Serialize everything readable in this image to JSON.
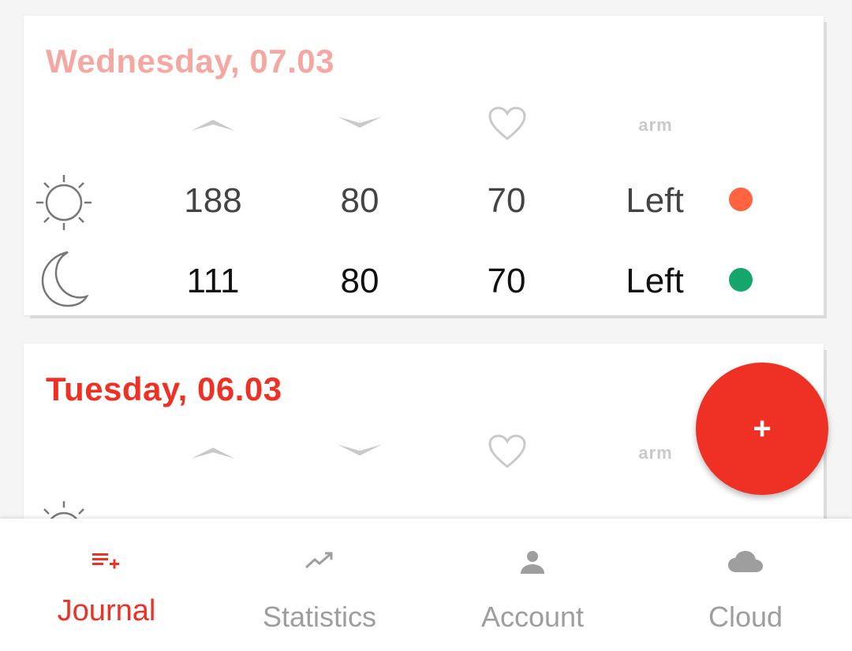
{
  "colors": {
    "accent": "#ee3124",
    "faded_accent": "#f5a8a2",
    "header_icon": "#c9c9c9",
    "inactive_nav": "#9e9e9e",
    "dot_red": "#ff6340",
    "dot_green": "#14a66b"
  },
  "journal": [
    {
      "date": "Wednesday, 07.03",
      "headers": {
        "systolic_icon": "chevron-up-icon",
        "diastolic_icon": "chevron-down-icon",
        "pulse_icon": "heart-icon",
        "arm_label": "arm"
      },
      "rows": [
        {
          "time_icon": "sun-icon",
          "systolic": "188",
          "diastolic": "80",
          "pulse": "70",
          "arm": "Left",
          "status_color": "#ff6340"
        },
        {
          "time_icon": "moon-icon",
          "systolic": "111",
          "diastolic": "80",
          "pulse": "70",
          "arm": "Left",
          "status_color": "#14a66b"
        }
      ]
    },
    {
      "date": "Tuesday, 06.03",
      "headers": {
        "systolic_icon": "chevron-up-icon",
        "diastolic_icon": "chevron-down-icon",
        "pulse_icon": "heart-icon",
        "arm_label": "arm"
      },
      "rows": [
        {
          "time_icon": "sunrise-icon",
          "systolic": "",
          "diastolic": "",
          "pulse": "",
          "arm": "",
          "status_color": "#14a66b"
        }
      ]
    }
  ],
  "fab": {
    "label": "+"
  },
  "nav": [
    {
      "label": "Journal",
      "icon": "playlist-add-icon",
      "active": true
    },
    {
      "label": "Statistics",
      "icon": "trending-up-icon",
      "active": false
    },
    {
      "label": "Account",
      "icon": "person-icon",
      "active": false
    },
    {
      "label": "Cloud",
      "icon": "cloud-icon",
      "active": false
    }
  ]
}
